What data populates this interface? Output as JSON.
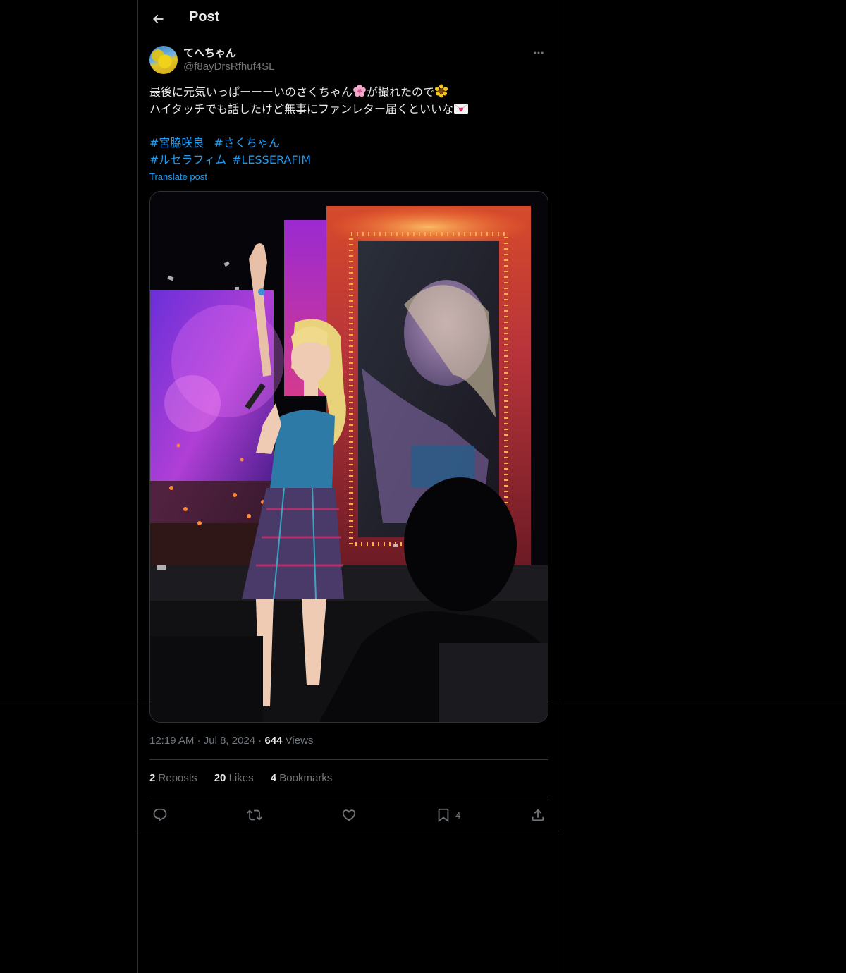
{
  "header": {
    "title": "Post"
  },
  "author": {
    "display_name": "てへちゃん",
    "handle": "@f8ayDrsRfhuf4SL"
  },
  "tweet": {
    "line1_a": "最後に元気いっぱーーーいのさくちゃん",
    "line1_b": "が撮れたので",
    "line2": "ハイタッチでも話したけど無事にファンレター届くといいな",
    "hashtags_row1": [
      "#宮脇咲良",
      "#さくちゃん"
    ],
    "hashtags_row2": [
      "#ルセラフィム",
      "#LESSERAFIM"
    ],
    "translate_label": "Translate post"
  },
  "meta": {
    "time": "12:19 AM",
    "separator": "·",
    "date": "Jul 8, 2024",
    "views_count": "644",
    "views_label": "Views"
  },
  "stats": {
    "reposts_count": "2",
    "reposts_label": "Reposts",
    "likes_count": "20",
    "likes_label": "Likes",
    "bookmarks_count": "4",
    "bookmarks_label": "Bookmarks"
  },
  "actions": {
    "bookmark_count": "4"
  },
  "icons": [
    "back-arrow-icon",
    "more-icon",
    "reply-icon",
    "repost-icon",
    "like-icon",
    "bookmark-icon",
    "share-icon"
  ],
  "colors": {
    "background": "#000000",
    "text": "#e7e9ea",
    "muted": "#71767b",
    "accent": "#1d9bf0",
    "border": "#2f3336"
  }
}
